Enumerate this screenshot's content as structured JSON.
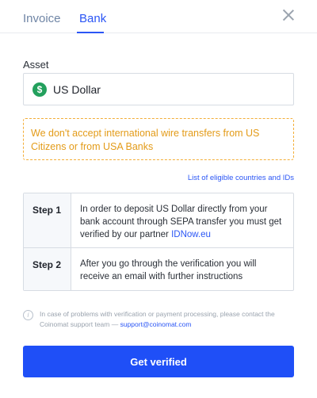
{
  "tabs": [
    {
      "label": "Invoice",
      "active": false
    },
    {
      "label": "Bank",
      "active": true
    }
  ],
  "accent_color": "#2b56f5",
  "asset": {
    "label": "Asset",
    "selected": "US Dollar",
    "icon": "dollar-icon",
    "icon_color": "#23a05d"
  },
  "warning": {
    "text": "We don't accept international wire transfers from US Citizens or from USA Banks",
    "color": "#e39b18"
  },
  "eligible_link": "List of eligible countries and IDs",
  "steps": [
    {
      "label": "Step 1",
      "text": "In order to deposit US Dollar directly from your bank account through SEPA transfer you must get verified by our partner ",
      "link": "IDNow.eu"
    },
    {
      "label": "Step 2",
      "text": "After you go through the verification you will receive an email with further instructions"
    }
  ],
  "info": {
    "text": "In case of problems with verification or payment processing, please contact the Coinomat support team — ",
    "link": "support@coinomat.com"
  },
  "cta_label": "Get verified"
}
